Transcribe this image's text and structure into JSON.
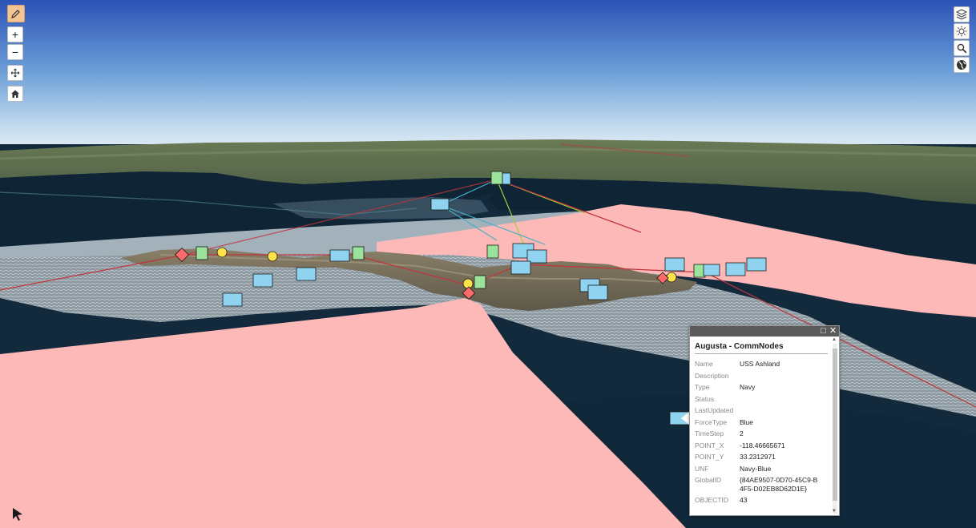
{
  "map": {
    "colors": {
      "sky_top": "#2d55b8",
      "sky_bottom": "#eef3f7",
      "water": "#10283a",
      "zone": "#fdb8b8",
      "friendly_sea": "#8fd3f0",
      "friendly_ground": "#9be29b",
      "hostile": "#ff6a6a",
      "unknown": "#ffe24a"
    }
  },
  "toolbar_left": {
    "icons": [
      "pencil-icon",
      "plus-icon",
      "minus-icon",
      "pan-icon",
      "home-icon"
    ],
    "zoom_in_label": "+",
    "zoom_out_label": "−"
  },
  "toolbar_right": {
    "icons": [
      "layers-icon",
      "sun-icon",
      "search-icon",
      "globe-icon"
    ]
  },
  "popup": {
    "title": "Augusta - CommNodes",
    "fields": [
      {
        "name": "Name",
        "value": "USS Ashland"
      },
      {
        "name": "Description",
        "value": ""
      },
      {
        "name": "Type",
        "value": "Navy"
      },
      {
        "name": "Status",
        "value": ""
      },
      {
        "name": "LastUpdated",
        "value": ""
      },
      {
        "name": "ForceType",
        "value": "Blue"
      },
      {
        "name": "TimeStep",
        "value": "2"
      },
      {
        "name": "POINT_X",
        "value": "-118.46665671"
      },
      {
        "name": "POINT_Y",
        "value": "33.2312971"
      },
      {
        "name": "UNF",
        "value": "Navy-Blue"
      },
      {
        "name": "GlobalID",
        "value": "{84AE9507-0D70-45C9-B4F5-D02EB8D62D1E}"
      },
      {
        "name": "OBJECTID",
        "value": "43"
      }
    ]
  }
}
